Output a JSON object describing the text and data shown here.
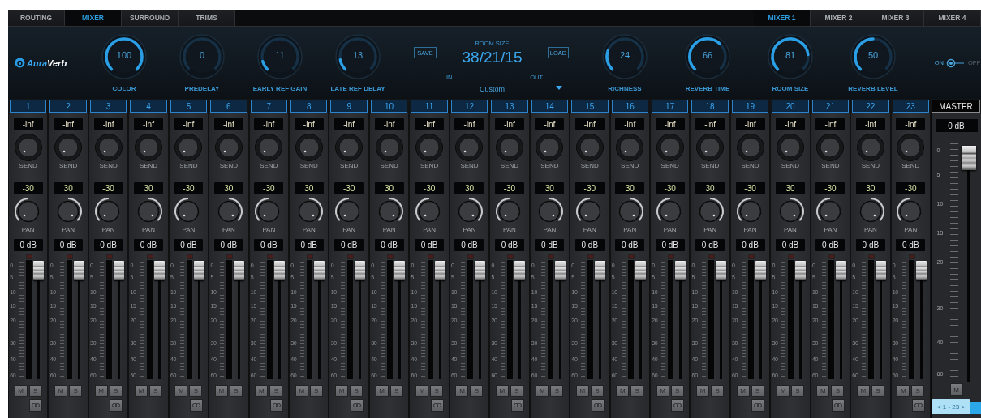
{
  "tabs": [
    {
      "label": "ROUTING",
      "selected": false
    },
    {
      "label": "MIXER",
      "selected": true
    },
    {
      "label": "SURROUND",
      "selected": false
    },
    {
      "label": "TRIMS",
      "selected": false
    }
  ],
  "mixer_tabs": [
    {
      "label": "MIXER 1",
      "selected": true
    },
    {
      "label": "MIXER 2",
      "selected": false
    },
    {
      "label": "MIXER 3",
      "selected": false
    },
    {
      "label": "MIXER 4",
      "selected": false
    }
  ],
  "logo": {
    "prefix": "Aura",
    "suffix": "Verb"
  },
  "knobs_left": [
    {
      "label": "COLOR",
      "value": "100",
      "level": 1
    },
    {
      "label": "PREDELAY",
      "value": "0"
    },
    {
      "label": "EARLY REF GAIN",
      "value": "11",
      "level": 0.11
    },
    {
      "label": "LATE REF DELAY",
      "value": "13",
      "level": 0.13
    }
  ],
  "room": {
    "title": "ROOM SIZE",
    "value": "38/21/15",
    "save": "SAVE",
    "load": "LOAD",
    "in_label": "IN",
    "out_label": "OUT",
    "preset": "Custom"
  },
  "knobs_right": [
    {
      "label": "RICHNESS",
      "value": "24",
      "level": 0.24
    },
    {
      "label": "REVERB TIME",
      "value": "66",
      "level": 0.66
    },
    {
      "label": "ROOM SIZE",
      "value": "81",
      "level": 0.81
    },
    {
      "label": "REVERB LEVEL",
      "value": "50",
      "level": 0.5
    }
  ],
  "power": {
    "on_label": "ON",
    "off_label": "OFF",
    "on": true
  },
  "channels": [
    {
      "number": "1",
      "send": {
        "value": "-inf"
      },
      "send_label": "SEND",
      "pan": {
        "value": "-30",
        "left": true
      },
      "pan_label": "PAN",
      "gain": "0 dB",
      "scale": [
        "0",
        "5",
        "10",
        "15",
        "20",
        "30",
        "40",
        "60"
      ],
      "fader": {
        "level": 0.95
      },
      "mute": "M",
      "solo": "S",
      "link": true
    },
    {
      "number": "2",
      "send": {
        "value": "-inf"
      },
      "send_label": "SEND",
      "pan": {
        "value": "30",
        "left": false
      },
      "pan_label": "PAN",
      "gain": "0 dB",
      "scale": [
        "0",
        "5",
        "10",
        "15",
        "20",
        "30",
        "40",
        "60"
      ],
      "fader": {
        "level": 0.95
      },
      "mute": "M",
      "solo": "S",
      "link": false
    },
    {
      "number": "3",
      "send": {
        "value": "-inf"
      },
      "send_label": "SEND",
      "pan": {
        "value": "-30",
        "left": true
      },
      "pan_label": "PAN",
      "gain": "0 dB",
      "scale": [
        "0",
        "5",
        "10",
        "15",
        "20",
        "30",
        "40",
        "60"
      ],
      "fader": {
        "level": 0.95
      },
      "mute": "M",
      "solo": "S",
      "link": true
    },
    {
      "number": "4",
      "send": {
        "value": "-inf"
      },
      "send_label": "SEND",
      "pan": {
        "value": "30",
        "left": false
      },
      "pan_label": "PAN",
      "gain": "0 dB",
      "scale": [
        "0",
        "5",
        "10",
        "15",
        "20",
        "30",
        "40",
        "60"
      ],
      "fader": {
        "level": 0.95
      },
      "mute": "M",
      "solo": "S",
      "link": false
    },
    {
      "number": "5",
      "send": {
        "value": "-inf"
      },
      "send_label": "SEND",
      "pan": {
        "value": "-30",
        "left": true
      },
      "pan_label": "PAN",
      "gain": "0 dB",
      "scale": [
        "0",
        "5",
        "10",
        "15",
        "20",
        "30",
        "40",
        "60"
      ],
      "fader": {
        "level": 0.95
      },
      "mute": "M",
      "solo": "S",
      "link": true
    },
    {
      "number": "6",
      "send": {
        "value": "-inf"
      },
      "send_label": "SEND",
      "pan": {
        "value": "30",
        "left": false
      },
      "pan_label": "PAN",
      "gain": "0 dB",
      "scale": [
        "0",
        "5",
        "10",
        "15",
        "20",
        "30",
        "40",
        "60"
      ],
      "fader": {
        "level": 0.95
      },
      "mute": "M",
      "solo": "S",
      "link": false
    },
    {
      "number": "7",
      "send": {
        "value": "-inf"
      },
      "send_label": "SEND",
      "pan": {
        "value": "-30",
        "left": true
      },
      "pan_label": "PAN",
      "gain": "0 dB",
      "scale": [
        "0",
        "5",
        "10",
        "15",
        "20",
        "30",
        "40",
        "60"
      ],
      "fader": {
        "level": 0.95
      },
      "mute": "M",
      "solo": "S",
      "link": true
    },
    {
      "number": "8",
      "send": {
        "value": "-inf"
      },
      "send_label": "SEND",
      "pan": {
        "value": "30",
        "left": false
      },
      "pan_label": "PAN",
      "gain": "0 dB",
      "scale": [
        "0",
        "5",
        "10",
        "15",
        "20",
        "30",
        "40",
        "60"
      ],
      "fader": {
        "level": 0.95
      },
      "mute": "M",
      "solo": "S",
      "link": false
    },
    {
      "number": "9",
      "send": {
        "value": "-inf"
      },
      "send_label": "SEND",
      "pan": {
        "value": "-30",
        "left": true
      },
      "pan_label": "PAN",
      "gain": "0 dB",
      "scale": [
        "0",
        "5",
        "10",
        "15",
        "20",
        "30",
        "40",
        "60"
      ],
      "fader": {
        "level": 0.95
      },
      "mute": "M",
      "solo": "S",
      "link": true
    },
    {
      "number": "10",
      "send": {
        "value": "-inf"
      },
      "send_label": "SEND",
      "pan": {
        "value": "30",
        "left": false
      },
      "pan_label": "PAN",
      "gain": "0 dB",
      "scale": [
        "0",
        "5",
        "10",
        "15",
        "20",
        "30",
        "40",
        "60"
      ],
      "fader": {
        "level": 0.95
      },
      "mute": "M",
      "solo": "S",
      "link": false
    },
    {
      "number": "11",
      "send": {
        "value": "-inf"
      },
      "send_label": "SEND",
      "pan": {
        "value": "-30",
        "left": true
      },
      "pan_label": "PAN",
      "gain": "0 dB",
      "scale": [
        "0",
        "5",
        "10",
        "15",
        "20",
        "30",
        "40",
        "60"
      ],
      "fader": {
        "level": 0.95
      },
      "mute": "M",
      "solo": "S",
      "link": true
    },
    {
      "number": "12",
      "send": {
        "value": "-inf"
      },
      "send_label": "SEND",
      "pan": {
        "value": "30",
        "left": false
      },
      "pan_label": "PAN",
      "gain": "0 dB",
      "scale": [
        "0",
        "5",
        "10",
        "15",
        "20",
        "30",
        "40",
        "60"
      ],
      "fader": {
        "level": 0.95
      },
      "mute": "M",
      "solo": "S",
      "link": false
    },
    {
      "number": "13",
      "send": {
        "value": "-inf"
      },
      "send_label": "SEND",
      "pan": {
        "value": "-30",
        "left": true
      },
      "pan_label": "PAN",
      "gain": "0 dB",
      "scale": [
        "0",
        "5",
        "10",
        "15",
        "20",
        "30",
        "40",
        "60"
      ],
      "fader": {
        "level": 0.95
      },
      "mute": "M",
      "solo": "S",
      "link": true
    },
    {
      "number": "14",
      "send": {
        "value": "-inf"
      },
      "send_label": "SEND",
      "pan": {
        "value": "30",
        "left": false
      },
      "pan_label": "PAN",
      "gain": "0 dB",
      "scale": [
        "0",
        "5",
        "10",
        "15",
        "20",
        "30",
        "40",
        "60"
      ],
      "fader": {
        "level": 0.95
      },
      "mute": "M",
      "solo": "S",
      "link": false
    },
    {
      "number": "15",
      "send": {
        "value": "-inf"
      },
      "send_label": "SEND",
      "pan": {
        "value": "-30",
        "left": true
      },
      "pan_label": "PAN",
      "gain": "0 dB",
      "scale": [
        "0",
        "5",
        "10",
        "15",
        "20",
        "30",
        "40",
        "60"
      ],
      "fader": {
        "level": 0.95
      },
      "mute": "M",
      "solo": "S",
      "link": true
    },
    {
      "number": "16",
      "send": {
        "value": "-inf"
      },
      "send_label": "SEND",
      "pan": {
        "value": "30",
        "left": false
      },
      "pan_label": "PAN",
      "gain": "0 dB",
      "scale": [
        "0",
        "5",
        "10",
        "15",
        "20",
        "30",
        "40",
        "60"
      ],
      "fader": {
        "level": 0.95
      },
      "mute": "M",
      "solo": "S",
      "link": false
    },
    {
      "number": "17",
      "send": {
        "value": "-inf"
      },
      "send_label": "SEND",
      "pan": {
        "value": "-30",
        "left": true
      },
      "pan_label": "PAN",
      "gain": "0 dB",
      "scale": [
        "0",
        "5",
        "10",
        "15",
        "20",
        "30",
        "40",
        "60"
      ],
      "fader": {
        "level": 0.95
      },
      "mute": "M",
      "solo": "S",
      "link": true
    },
    {
      "number": "18",
      "send": {
        "value": "-inf"
      },
      "send_label": "SEND",
      "pan": {
        "value": "30",
        "left": false
      },
      "pan_label": "PAN",
      "gain": "0 dB",
      "scale": [
        "0",
        "5",
        "10",
        "15",
        "20",
        "30",
        "40",
        "60"
      ],
      "fader": {
        "level": 0.95
      },
      "mute": "M",
      "solo": "S",
      "link": false
    },
    {
      "number": "19",
      "send": {
        "value": "-inf"
      },
      "send_label": "SEND",
      "pan": {
        "value": "-30",
        "left": true
      },
      "pan_label": "PAN",
      "gain": "0 dB",
      "scale": [
        "0",
        "5",
        "10",
        "15",
        "20",
        "30",
        "40",
        "60"
      ],
      "fader": {
        "level": 0.95
      },
      "mute": "M",
      "solo": "S",
      "link": true
    },
    {
      "number": "20",
      "send": {
        "value": "-inf"
      },
      "send_label": "SEND",
      "pan": {
        "value": "30",
        "left": false
      },
      "pan_label": "PAN",
      "gain": "0 dB",
      "scale": [
        "0",
        "5",
        "10",
        "15",
        "20",
        "30",
        "40",
        "60"
      ],
      "fader": {
        "level": 0.95
      },
      "mute": "M",
      "solo": "S",
      "link": false
    },
    {
      "number": "21",
      "send": {
        "value": "-inf"
      },
      "send_label": "SEND",
      "pan": {
        "value": "-30",
        "left": true
      },
      "pan_label": "PAN",
      "gain": "0 dB",
      "scale": [
        "0",
        "5",
        "10",
        "15",
        "20",
        "30",
        "40",
        "60"
      ],
      "fader": {
        "level": 0.95
      },
      "mute": "M",
      "solo": "S",
      "link": true
    },
    {
      "number": "22",
      "send": {
        "value": "-inf"
      },
      "send_label": "SEND",
      "pan": {
        "value": "30",
        "left": false
      },
      "pan_label": "PAN",
      "gain": "0 dB",
      "scale": [
        "0",
        "5",
        "10",
        "15",
        "20",
        "30",
        "40",
        "60"
      ],
      "fader": {
        "level": 0.95
      },
      "mute": "M",
      "solo": "S",
      "link": false
    },
    {
      "number": "23",
      "send": {
        "value": "-inf"
      },
      "send_label": "SEND",
      "pan": {
        "value": "-30",
        "left": true
      },
      "pan_label": "PAN",
      "gain": "0 dB",
      "scale": [
        "0",
        "5",
        "10",
        "15",
        "20",
        "30",
        "40",
        "60"
      ],
      "fader": {
        "level": 0.95
      },
      "mute": "M",
      "solo": "S",
      "link": true
    }
  ],
  "master": {
    "label": "MASTER",
    "gain": "0 dB",
    "scale": [
      "0",
      "5",
      "10",
      "15",
      "20",
      "30",
      "40",
      "60"
    ],
    "fader": {
      "level": 0.95
    },
    "mute": "M",
    "pager": "< 1 - 23 >"
  }
}
